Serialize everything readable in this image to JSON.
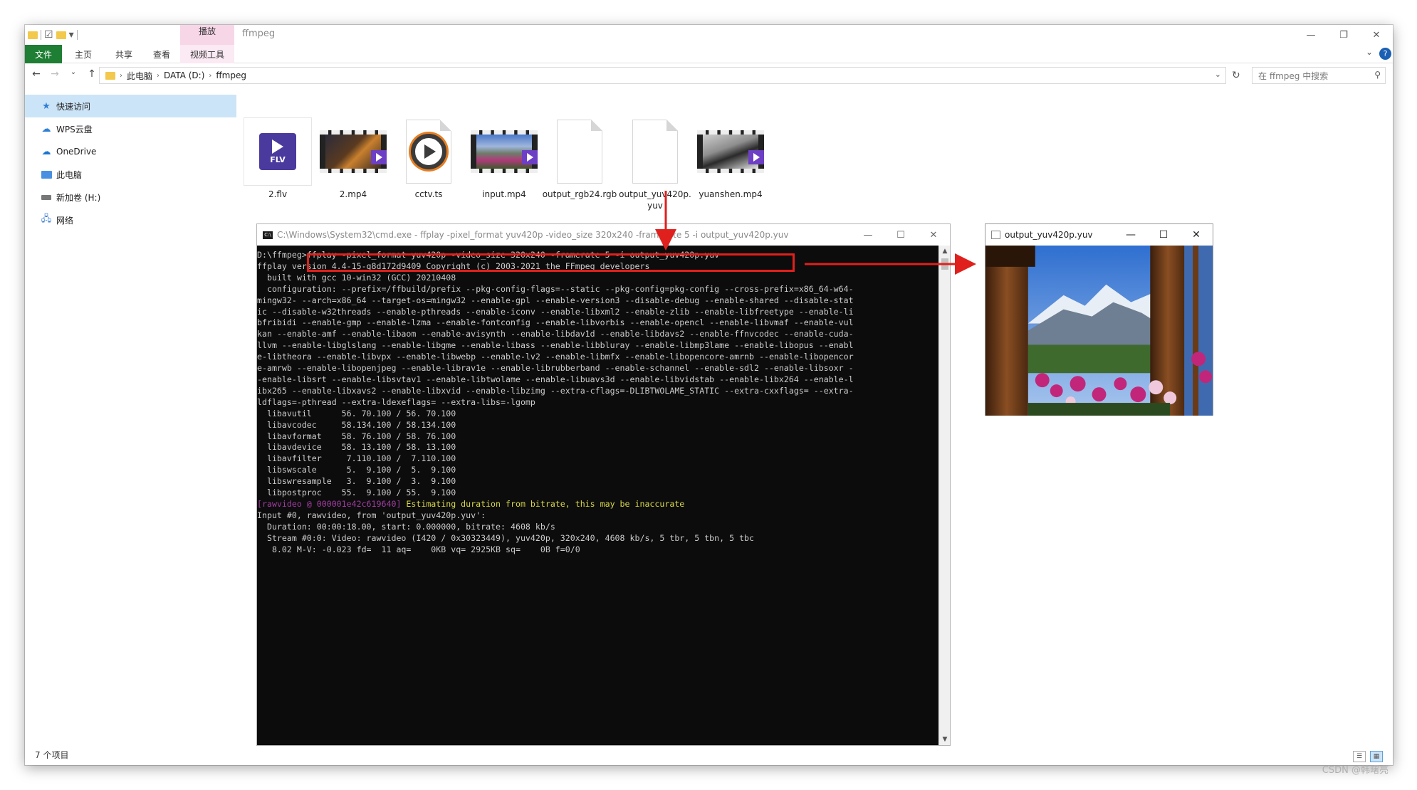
{
  "explorer": {
    "title": "ffmpeg",
    "ribbon": {
      "context_label": "播放",
      "tabs": [
        "文件",
        "主页",
        "共享",
        "查看",
        "视频工具"
      ]
    },
    "address": {
      "crumbs": [
        "此电脑",
        "DATA (D:)",
        "ffmpeg"
      ]
    },
    "search_placeholder": "在 ffmpeg 中搜索",
    "sidebar": {
      "items": [
        {
          "label": "快速访问",
          "icon": "star-icon"
        },
        {
          "label": "WPS云盘",
          "icon": "cloud-icon"
        },
        {
          "label": "OneDrive",
          "icon": "onedrive-icon"
        },
        {
          "label": "此电脑",
          "icon": "computer-icon"
        },
        {
          "label": "新加卷 (H:)",
          "icon": "drive-icon"
        },
        {
          "label": "网络",
          "icon": "network-icon"
        }
      ]
    },
    "files": [
      {
        "name": "2.flv",
        "kind": "flv"
      },
      {
        "name": "2.mp4",
        "kind": "video"
      },
      {
        "name": "cctv.ts",
        "kind": "ts"
      },
      {
        "name": "input.mp4",
        "kind": "video"
      },
      {
        "name": "output_rgb24.rgb",
        "kind": "doc"
      },
      {
        "name": "output_yuv420p.yuv",
        "kind": "doc"
      },
      {
        "name": "yuanshen.mp4",
        "kind": "video"
      }
    ],
    "flv_icon_text": "FLV",
    "status": "7 个项目"
  },
  "cmd": {
    "title": "C:\\Windows\\System32\\cmd.exe - ffplay  -pixel_format yuv420p -video_size 320x240 -framerate 5 -i output_yuv420p.yuv",
    "prompt": "D:\\ffmpeg>",
    "command": "ffplay -pixel_format yuv420p -video_size 320x240 -framerate 5 -i output_yuv420p.yuv",
    "lines": [
      "ffplay version 4.4-15-g8d172d9409 Copyright (c) 2003-2021 the FFmpeg developers",
      "  built with gcc 10-win32 (GCC) 20210408",
      "  configuration: --prefix=/ffbuild/prefix --pkg-config-flags=--static --pkg-config=pkg-config --cross-prefix=x86_64-w64-",
      "mingw32- --arch=x86_64 --target-os=mingw32 --enable-gpl --enable-version3 --disable-debug --enable-shared --disable-stat",
      "ic --disable-w32threads --enable-pthreads --enable-iconv --enable-libxml2 --enable-zlib --enable-libfreetype --enable-li",
      "bfribidi --enable-gmp --enable-lzma --enable-fontconfig --enable-libvorbis --enable-opencl --enable-libvmaf --enable-vul",
      "kan --enable-amf --enable-libaom --enable-avisynth --enable-libdav1d --enable-libdavs2 --enable-ffnvcodec --enable-cuda-",
      "llvm --enable-libglslang --enable-libgme --enable-libass --enable-libbluray --enable-libmp3lame --enable-libopus --enabl",
      "e-libtheora --enable-libvpx --enable-libwebp --enable-lv2 --enable-libmfx --enable-libopencore-amrnb --enable-libopencor",
      "e-amrwb --enable-libopenjpeg --enable-librav1e --enable-librubberband --enable-schannel --enable-sdl2 --enable-libsoxr -",
      "-enable-libsrt --enable-libsvtav1 --enable-libtwolame --enable-libuavs3d --enable-libvidstab --enable-libx264 --enable-l",
      "ibx265 --enable-libxavs2 --enable-libxvid --enable-libzimg --extra-cflags=-DLIBTWOLAME_STATIC --extra-cxxflags= --extra-",
      "ldflags=-pthread --extra-ldexeflags= --extra-libs=-lgomp",
      "  libavutil      56. 70.100 / 56. 70.100",
      "  libavcodec     58.134.100 / 58.134.100",
      "  libavformat    58. 76.100 / 58. 76.100",
      "  libavdevice    58. 13.100 / 58. 13.100",
      "  libavfilter     7.110.100 /  7.110.100",
      "  libswscale      5.  9.100 /  5.  9.100",
      "  libswresample   3.  9.100 /  3.  9.100",
      "  libpostproc    55.  9.100 / 55.  9.100"
    ],
    "warn_tag": "[rawvideo @ 000001e42c619640]",
    "warn_msg": " Estimating duration from bitrate, this may be inaccurate",
    "tail_lines": [
      "Input #0, rawvideo, from 'output_yuv420p.yuv':",
      "  Duration: 00:00:18.00, start: 0.000000, bitrate: 4608 kb/s",
      "  Stream #0:0: Video: rawvideo (I420 / 0x30323449), yuv420p, 320x240, 4608 kb/s, 5 tbr, 5 tbn, 5 tbc",
      "   8.02 M-V: -0.023 fd=  11 aq=    0KB vq= 2925KB sq=    0B f=0/0"
    ]
  },
  "player": {
    "title": "output_yuv420p.yuv"
  },
  "watermark": "CSDN @韩曙亮",
  "colors": {
    "file_tab": "#1e7e34",
    "annotation": "#e0201c",
    "warn_tag": "#a23ca2",
    "warn_msg": "#d7d74a"
  }
}
